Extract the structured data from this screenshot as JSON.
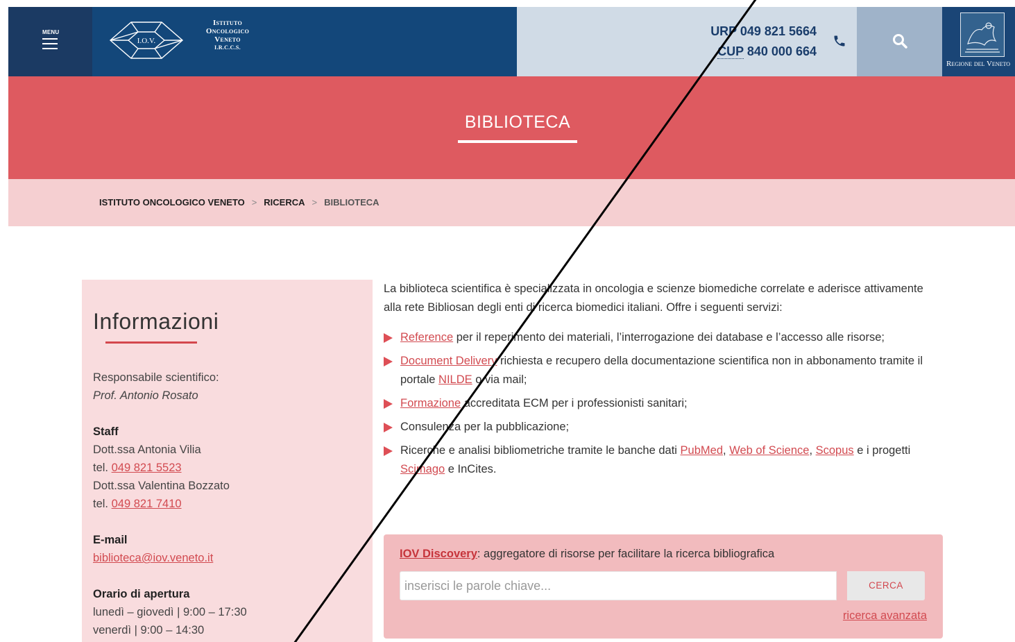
{
  "header": {
    "menu_label": "MENU",
    "logo": {
      "mark_text": "I.O.V.",
      "line1": "Istituto",
      "line2": "Oncologico",
      "line3": "Veneto",
      "line4": "I.R.C.C.S."
    },
    "contacts": {
      "urp_label": "URP",
      "urp_number": "049 821 5664",
      "cup_label": "CUP",
      "cup_number": "840 000 664"
    },
    "region_label": "Regione del Veneto"
  },
  "page_title": "BIBLIOTECA",
  "breadcrumb": [
    "ISTITUTO ONCOLOGICO VENETO",
    "RICERCA",
    "BIBLIOTECA"
  ],
  "breadcrumb_sep": ">",
  "sidebar": {
    "title": "Informazioni",
    "responsible_label": "Responsabile scientifico:",
    "responsible_name": "Prof. Antonio Rosato",
    "staff_label": "Staff",
    "staff": [
      {
        "name": "Dott.ssa Antonia Vilia",
        "tel_prefix": "tel.",
        "tel": "049 821 5523"
      },
      {
        "name": "Dott.ssa Valentina Bozzato",
        "tel_prefix": "tel.",
        "tel": "049 821 7410"
      }
    ],
    "email_label": "E-mail",
    "email": "biblioteca@iov.veneto.it",
    "hours_label": "Orario di apertura",
    "hours": [
      "lunedì – giovedì | 9:00 – 17:30",
      "venerdì | 9:00 – 14:30"
    ]
  },
  "intro": "La biblioteca scientifica è specializzata in oncologia e scienze biomediche correlate e aderisce attivamente alla rete Bibliosan degli enti di ricerca biomedici italiani. Offre i seguenti servizi:",
  "services": {
    "s1_link": "Reference",
    "s1_text": " per il reperimento dei materiali, l’interrogazione dei database e l’accesso alle risorse;",
    "s2_link": "Document Delivery",
    "s2_text_a": " richiesta e recupero della documentazione scientifica non in abbonamento tramite il portale ",
    "s2_link2": "NILDE",
    "s2_text_b": " o via mail;",
    "s3_link": "Formazione",
    "s3_text": " accreditata ECM per i professionisti sanitari;",
    "s4_text": "Consulenza per la pubblicazione;",
    "s5_text_a": "Ricerche e analisi bibliometriche tramite le banche dati ",
    "s5_link_pubmed": "PubMed",
    "comma": ", ",
    "s5_link_wos": "Web of Science",
    "s5_link_scopus": "Scopus",
    "s5_text_b": " e i progetti ",
    "s5_link_scimago": "Scimago",
    "s5_text_c": " e InCites."
  },
  "discovery": {
    "link": "IOV Discovery",
    "text": ": aggregatore di risorse per facilitare la ricerca bibliografica",
    "placeholder": "inserisci le parole chiave...",
    "button": "CERCA",
    "advanced": "ricerca avanzata"
  },
  "colors": {
    "navy": "#13477a",
    "coral": "#de5a60",
    "pink_light": "#f5cfd1",
    "link_red": "#d24a50"
  }
}
